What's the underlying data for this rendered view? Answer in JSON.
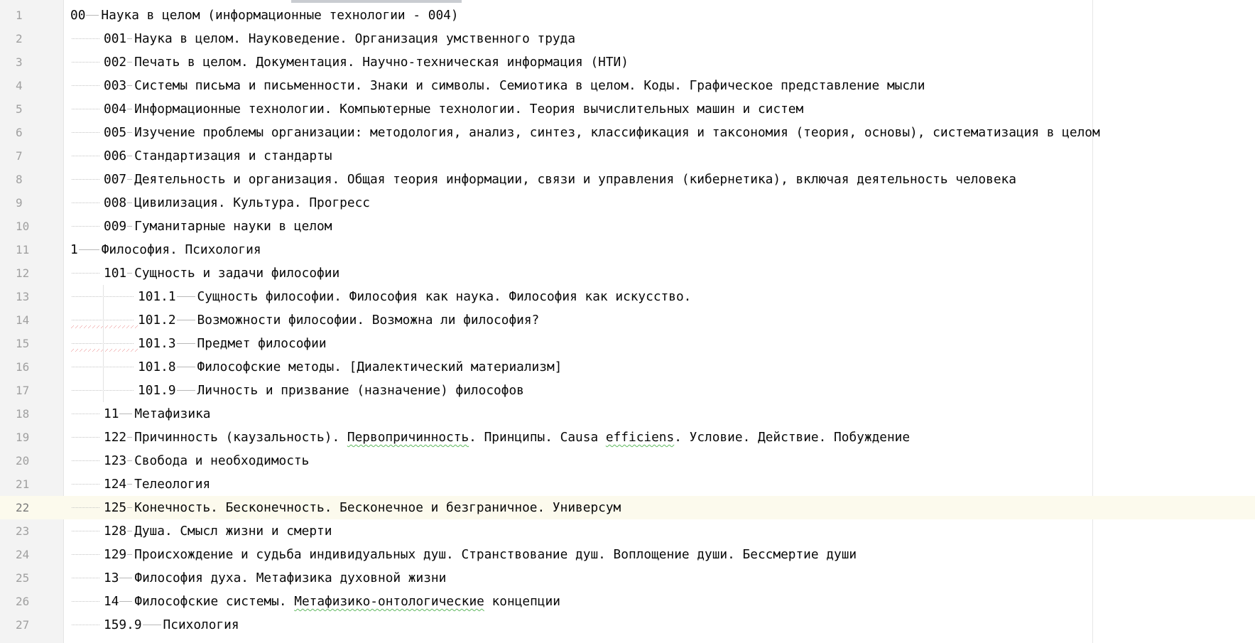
{
  "editor": {
    "lines": [
      {
        "number": "1",
        "code": "00",
        "title": "Наука в целом (информационные технологии - 004)"
      },
      {
        "number": "2",
        "code": "001",
        "title": "Наука в целом. Науковедение. Организация умственного труда"
      },
      {
        "number": "3",
        "code": "002",
        "title": "Печать в целом. Документация. Научно-техническая информация (НТИ)"
      },
      {
        "number": "4",
        "code": "003",
        "title": "Системы письма и письменности. Знаки и символы. Семиотика в целом. Коды. Графическое представление мысли"
      },
      {
        "number": "5",
        "code": "004",
        "title": "Информационные технологии. Компьютерные технологии. Теория вычислительных машин и систем"
      },
      {
        "number": "6",
        "code": "005",
        "title": "Изучение проблемы организации: методология, анализ, синтез, классификация и таксономия (теория, основы), систематизация в целом"
      },
      {
        "number": "7",
        "code": "006",
        "title": "Стандартизация и стандарты"
      },
      {
        "number": "8",
        "code": "007",
        "title": "Деятельность и организация. Общая теория информации, связи и управления (кибернетика), включая деятельность человека"
      },
      {
        "number": "9",
        "code": "008",
        "title": "Цивилизация. Культура. Прогресс"
      },
      {
        "number": "10",
        "code": "009",
        "title": "Гуманитарные науки в целом"
      },
      {
        "number": "11",
        "code": "1",
        "title": "Философия. Психология"
      },
      {
        "number": "12",
        "code": "101",
        "title": "Сущность и задачи философии"
      },
      {
        "number": "13",
        "code": "101.1",
        "title": "Сущность философии. Философия как наука. Философия как искусство."
      },
      {
        "number": "14",
        "code": "101.2",
        "title": "Возможности философии. Возможна ли философия?"
      },
      {
        "number": "15",
        "code": "101.3",
        "title": "Предмет философии"
      },
      {
        "number": "16",
        "code": "101.8",
        "title": "Философские методы. [Диалектический материализм]"
      },
      {
        "number": "17",
        "code": "101.9",
        "title": "Личность и призвание (назначение) философов"
      },
      {
        "number": "18",
        "code": "11",
        "title": "Метафизика"
      },
      {
        "number": "19",
        "code": "122",
        "title_parts": [
          "Причинность (каузальность). ",
          "Первопричинность",
          ". Принципы. Causa ",
          "efficiens",
          ". Условие. Действие. Побуждение"
        ]
      },
      {
        "number": "20",
        "code": "123",
        "title": "Свобода и необходимость"
      },
      {
        "number": "21",
        "code": "124",
        "title": "Телеология"
      },
      {
        "number": "22",
        "code": "125",
        "title": "Конечность. Бесконечность. Бесконечное и безграничное. Универсум"
      },
      {
        "number": "23",
        "code": "128",
        "title": "Душа. Смысл жизни и смерти"
      },
      {
        "number": "24",
        "code": "129",
        "title": "Происхождение и судьба индивидуальных душ. Странствование душ. Воплощение души. Бессмертие души"
      },
      {
        "number": "25",
        "code": "13",
        "title": "Философия духа. Метафизика духовной жизни"
      },
      {
        "number": "26",
        "code": "14",
        "title_parts": [
          "Философские системы. ",
          "Метафизико-онтологические",
          " концепции"
        ]
      },
      {
        "number": "27",
        "code": "159.9",
        "title": "Психология"
      }
    ]
  },
  "colors": {
    "text": "#080808",
    "line_number": "#a0a0a0",
    "gutter_bg": "#f3f3f3",
    "current_line_bg": "#fcfaed",
    "spell_underline": "#5fb85f",
    "warning_underline": "#e36a6a"
  }
}
